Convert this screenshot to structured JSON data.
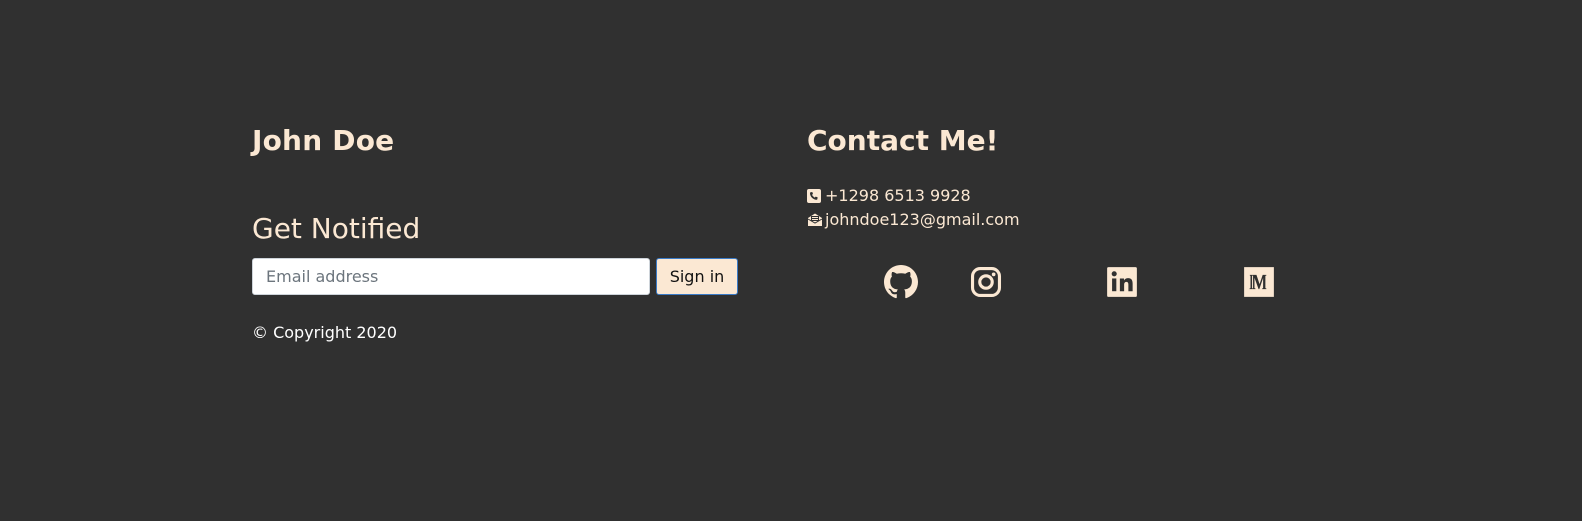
{
  "brand": {
    "name": "John Doe"
  },
  "newsletter": {
    "title": "Get Notified",
    "email_placeholder": "Email address",
    "submit_label": "Sign in"
  },
  "copyright": "© Copyright 2020",
  "contact": {
    "title": "Contact Me!",
    "phone": "+1298 6513 9928",
    "email": "johndoe123@gmail.com",
    "phone_icon": "phone-square-icon",
    "email_icon": "envelope-open-icon"
  },
  "socials": [
    {
      "name": "github",
      "icon": "github-icon"
    },
    {
      "name": "instagram",
      "icon": "instagram-icon"
    },
    {
      "name": "linkedin",
      "icon": "linkedin-icon"
    },
    {
      "name": "medium",
      "icon": "medium-icon"
    }
  ],
  "colors": {
    "background": "#303030",
    "accent": "#fbe8d3",
    "button_border": "#3a7bc8"
  }
}
